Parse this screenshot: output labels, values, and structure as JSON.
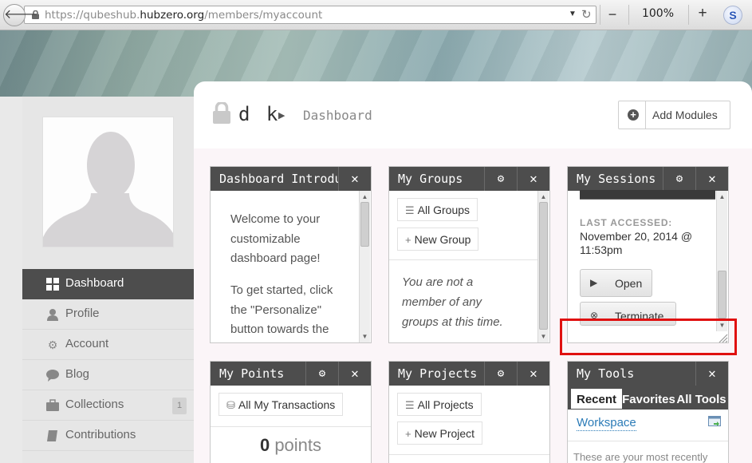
{
  "browser": {
    "url_prefix": "https://qubeshub.",
    "url_domain": "hubzero.org",
    "url_path": "/members/myaccount",
    "zoom_minus": "−",
    "zoom_level": "100%",
    "zoom_plus": "+",
    "addon_letter": "S"
  },
  "profile": {
    "user_name": "d k",
    "breadcrumb_page": "Dashboard",
    "add_modules_label": "Add Modules"
  },
  "sidebar": {
    "items": [
      {
        "label": "Dashboard",
        "icon": "grid-icon",
        "glyph": "▦",
        "active": true
      },
      {
        "label": "Profile",
        "icon": "user-icon",
        "glyph": "👤"
      },
      {
        "label": "Account",
        "icon": "gears-icon",
        "glyph": "⚙"
      },
      {
        "label": "Blog",
        "icon": "comment-icon",
        "glyph": "💬"
      },
      {
        "label": "Collections",
        "icon": "briefcase-icon",
        "glyph": "▬",
        "badge": "1"
      },
      {
        "label": "Contributions",
        "icon": "book-icon",
        "glyph": "▰"
      }
    ]
  },
  "modules": {
    "intro": {
      "title": "Dashboard Introducti",
      "close_glyph": "✕",
      "lines": [
        "Welcome to your",
        "customizable",
        "dashboard page!",
        "To get started, click",
        "the \"Personalize\"",
        "button towards the"
      ]
    },
    "groups": {
      "title": "My Groups",
      "gear_glyph": "⚙",
      "close_glyph": "✕",
      "all_groups": "All Groups",
      "new_group": "New Group",
      "note_lines": [
        "You are not a",
        "member of any",
        "groups at this time."
      ]
    },
    "sessions": {
      "title": "My Sessions",
      "gear_glyph": "⚙",
      "close_glyph": "✕",
      "last_accessed_label": "LAST ACCESSED:",
      "date_line1": "November 20, 2014 @",
      "date_line2": "11:53pm",
      "open_label": "Open",
      "terminate_label": "Terminate"
    },
    "points": {
      "title": "My Points",
      "gear_glyph": "⚙",
      "close_glyph": "✕",
      "transactions": "All My Transactions",
      "points_number": "0",
      "points_unit": " points"
    },
    "projects": {
      "title": "My Projects",
      "gear_glyph": "⚙",
      "close_glyph": "✕",
      "all_projects": "All Projects",
      "new_project": "New Project"
    },
    "tools": {
      "title": "My Tools",
      "close_glyph": "✕",
      "tabs": [
        "Recent",
        "Favorites",
        "All Tools"
      ],
      "workspace": "Workspace",
      "note": "These are your most recently"
    }
  },
  "colors": {
    "header_dark": "#4d4d4d",
    "link_blue": "#2b7bb7",
    "highlight_red": "#e01010"
  }
}
